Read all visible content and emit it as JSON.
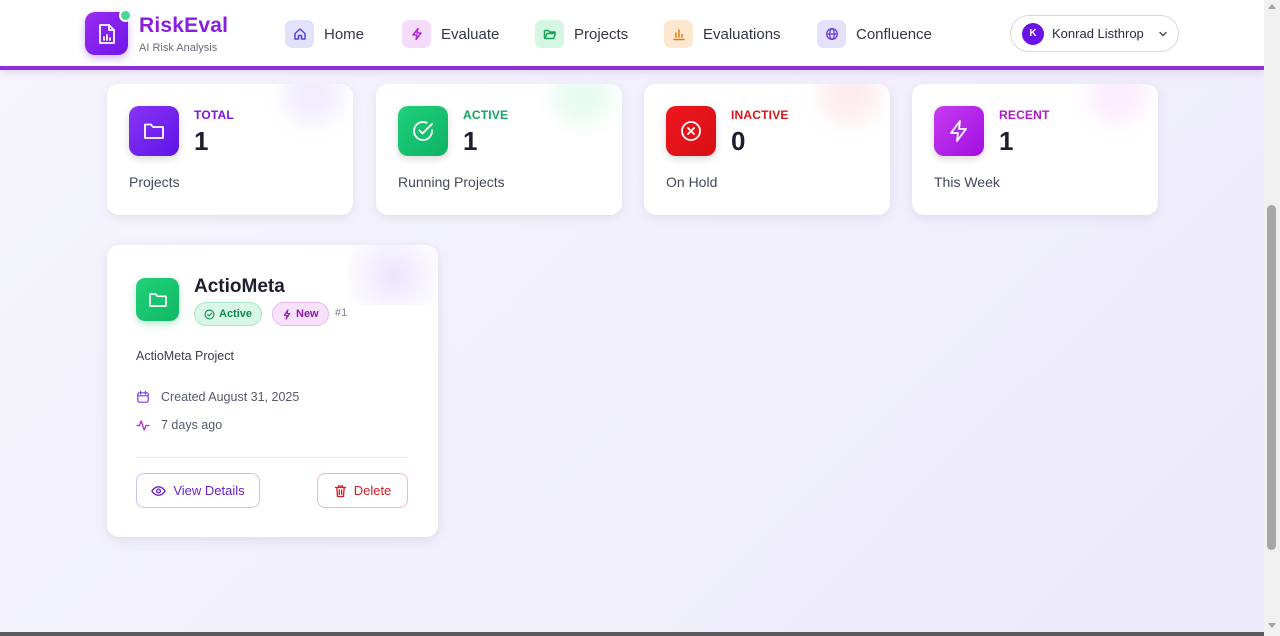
{
  "header": {
    "brand_name": "RiskEval",
    "brand_subtitle": "AI Risk Analysis",
    "nav": [
      {
        "label": "Home",
        "icon": "home-icon",
        "icon_bg": "#e3e2fb",
        "icon_color": "#5b3fd6"
      },
      {
        "label": "Evaluate",
        "icon": "lightning-icon",
        "icon_bg": "#f6dcfb",
        "icon_color": "#b12bd8"
      },
      {
        "label": "Projects",
        "icon": "folder-open-icon",
        "icon_bg": "#d6f6e4",
        "icon_color": "#17a45a"
      },
      {
        "label": "Evaluations",
        "icon": "bar-chart-icon",
        "icon_bg": "#fde8cf",
        "icon_color": "#e07c12"
      },
      {
        "label": "Confluence",
        "icon": "globe-icon",
        "icon_bg": "#e5e0fb",
        "icon_color": "#6a3fd6"
      }
    ],
    "user": {
      "initial": "K",
      "name": "Konrad Listhrop"
    }
  },
  "stats": [
    {
      "label": "TOTAL",
      "value": "1",
      "caption": "Projects",
      "icon": "folder-icon",
      "label_color": "#7b14e0",
      "icon_gradient": [
        "#8a34f5",
        "#5d14e6"
      ]
    },
    {
      "label": "ACTIVE",
      "value": "1",
      "caption": "Running Projects",
      "icon": "check-circle-icon",
      "label_color": "#12a35d",
      "icon_gradient": [
        "#1fd07a",
        "#0db364"
      ]
    },
    {
      "label": "INACTIVE",
      "value": "0",
      "caption": "On Hold",
      "icon": "x-circle-icon",
      "label_color": "#d9141c",
      "icon_gradient": [
        "#f0161e",
        "#d80f15"
      ]
    },
    {
      "label": "RECENT",
      "value": "1",
      "caption": "This Week",
      "icon": "lightning-icon",
      "label_color": "#b116c9",
      "icon_gradient": [
        "#c63cf2",
        "#a10ee0"
      ]
    }
  ],
  "project": {
    "title": "ActioMeta",
    "badge_active": "Active",
    "badge_new": "New",
    "number": "#1",
    "description": "ActioMeta Project",
    "created": "Created August 31, 2025",
    "updated": "7 days ago",
    "view_label": "View Details",
    "delete_label": "Delete"
  }
}
